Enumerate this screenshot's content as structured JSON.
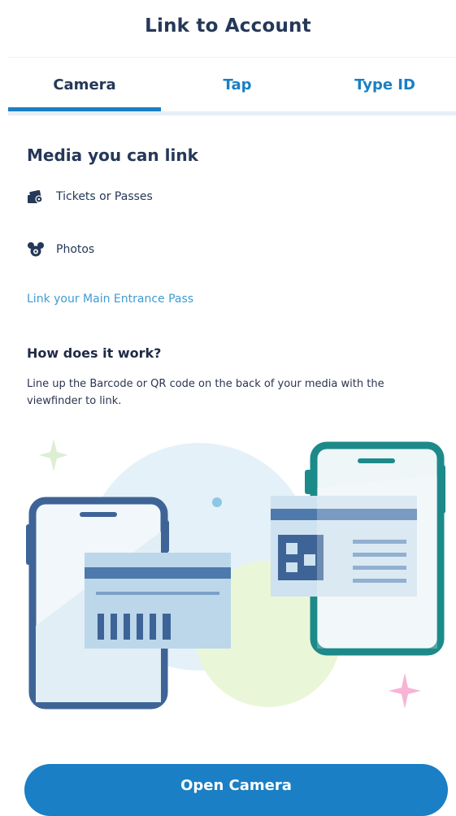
{
  "header": {
    "title": "Link to Account"
  },
  "tabs": [
    {
      "label": "Camera",
      "active": true
    },
    {
      "label": "Tap",
      "active": false
    },
    {
      "label": "Type ID",
      "active": false
    }
  ],
  "media": {
    "title": "Media you can link",
    "items": [
      {
        "label": "Tickets or Passes",
        "icon": "ticket-icon"
      },
      {
        "label": "Photos",
        "icon": "mickey-icon"
      }
    ],
    "link_label": "Link your Main Entrance Pass"
  },
  "how": {
    "title": "How does it work?",
    "text": "Line up the Barcode or QR code on the back of your media with the viewfinder to link."
  },
  "action": {
    "label": "Open Camera"
  },
  "colors": {
    "accent": "#1a7fc4",
    "heading": "#253858",
    "link": "#3f9bd3"
  }
}
